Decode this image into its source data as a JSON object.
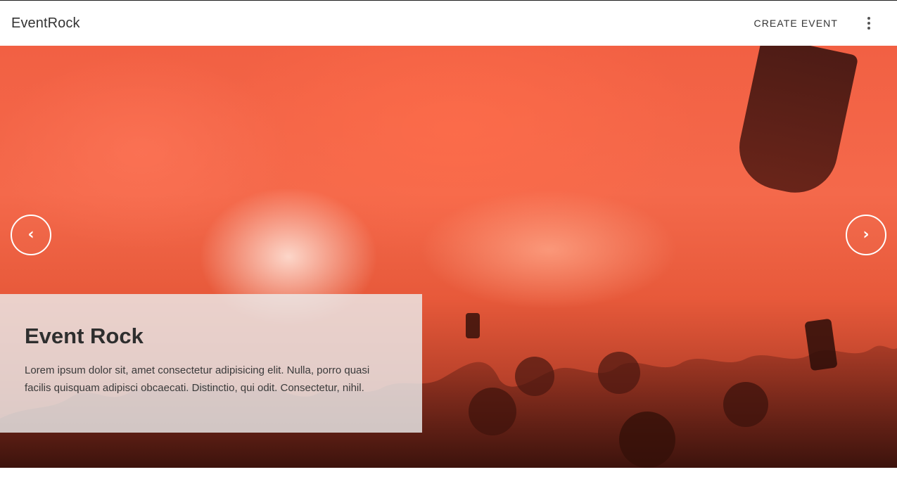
{
  "appbar": {
    "brand": "EventRock",
    "create_label": "CREATE EVENT",
    "more_icon": "more-vert-icon"
  },
  "hero": {
    "prev_icon": "chevron-left-icon",
    "next_icon": "chevron-right-icon",
    "prev_glyph": "‹",
    "next_glyph": "›",
    "title": "Event Rock",
    "description": "Lorem ipsum dolor sit, amet consectetur adipisicing elit. Nulla, porro quasi facilis quisquam adipisci obcaecati. Distinctio, qui odit. Consectetur, nihil."
  },
  "colors": {
    "hero_accent": "#f26043",
    "text_dark": "#333333"
  }
}
